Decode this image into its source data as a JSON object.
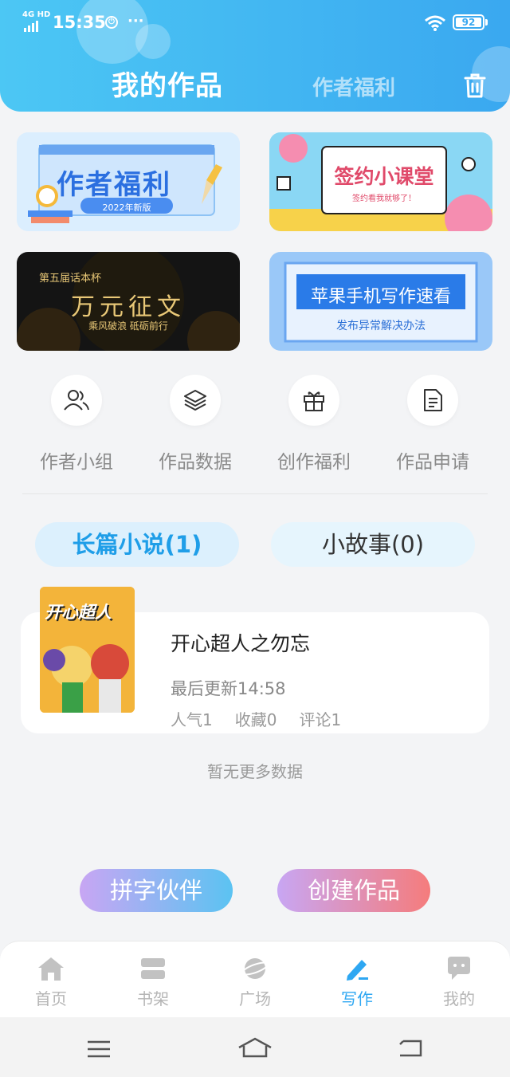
{
  "status_bar": {
    "network": "4G HD",
    "time": "15:35",
    "battery": "92"
  },
  "header": {
    "tab_active": "我的作品",
    "tab_inactive": "作者福利"
  },
  "banners": [
    {
      "title": "作者福利",
      "subtitle": "2022年新版"
    },
    {
      "title": "签约小课堂",
      "subtitle": "签约看我就够了！"
    },
    {
      "title": "万元征文",
      "top": "第五届话本杯",
      "subtitle": "乘风破浪 砥砺前行"
    },
    {
      "title": "苹果手机写作速看",
      "subtitle": "发布异常解决办法"
    }
  ],
  "quick_actions": [
    {
      "label": "作者小组",
      "icon": "users-icon"
    },
    {
      "label": "作品数据",
      "icon": "layers-icon"
    },
    {
      "label": "创作福利",
      "icon": "gift-icon"
    },
    {
      "label": "作品申请",
      "icon": "document-icon"
    }
  ],
  "works_tabs": {
    "novel": "长篇小说(1)",
    "story": "小故事(0)"
  },
  "book": {
    "cover_text": "开心超人",
    "title": "开心超人之勿忘",
    "updated": "最后更新14:58",
    "popularity": "人气1",
    "favorites": "收藏0",
    "comments": "评论1"
  },
  "no_more": "暂无更多数据",
  "buttons": {
    "partner": "拼字伙伴",
    "create": "创建作品"
  },
  "tabbar": [
    {
      "label": "首页",
      "icon": "home-icon"
    },
    {
      "label": "书架",
      "icon": "bookshelf-icon"
    },
    {
      "label": "广场",
      "icon": "planet-icon"
    },
    {
      "label": "写作",
      "icon": "pen-icon",
      "active": true
    },
    {
      "label": "我的",
      "icon": "chat-icon"
    }
  ],
  "colors": {
    "accent": "#2ea7f2",
    "header_start": "#4cc7f4",
    "header_end": "#3aa8f0"
  }
}
